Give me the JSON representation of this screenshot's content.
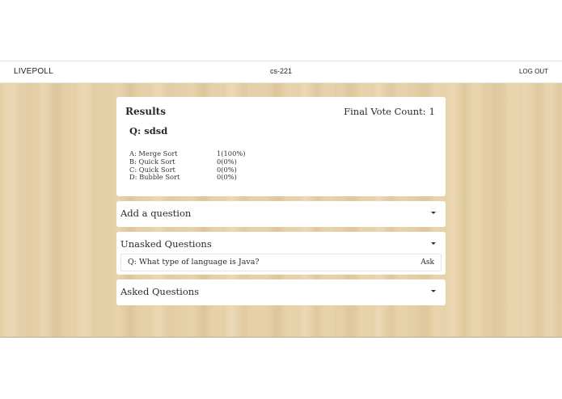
{
  "header": {
    "brand": "LIVEPOLL",
    "room_code": "cs-221",
    "logout_label": "LOG OUT"
  },
  "results": {
    "title": "Results",
    "final_vote_count_label": "Final Vote Count:",
    "final_vote_count_value": "1",
    "question": "Q: sdsd",
    "answers": [
      {
        "label": "A: Merge Sort",
        "stats": "1(100%)"
      },
      {
        "label": "B: Quick Sort",
        "stats": "0(0%)"
      },
      {
        "label": "C: Quick Sort",
        "stats": "0(0%)"
      },
      {
        "label": "D: Bubble Sort",
        "stats": "0(0%)"
      }
    ]
  },
  "sections": {
    "add_question": {
      "title": "Add a question"
    },
    "unasked": {
      "title": "Unasked Questions",
      "questions": [
        {
          "text": "Q: What type of language is Java?",
          "action_label": "Ask"
        }
      ]
    },
    "asked": {
      "title": "Asked Questions"
    }
  }
}
